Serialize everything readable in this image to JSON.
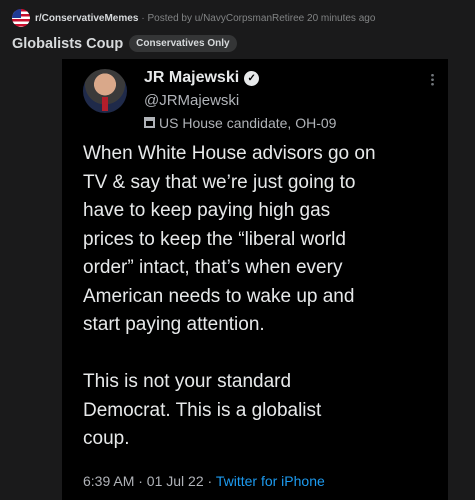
{
  "post": {
    "subreddit": "r/ConservativeMemes",
    "byline": "· Posted by u/NavyCorpsmanRetiree 20 minutes ago",
    "title": "Globalists Coup",
    "flair": "Conservatives Only"
  },
  "tweet": {
    "author_name": "JR Majewski",
    "verified_mark": "✓",
    "handle": "@JRMajewski",
    "label": "US House candidate, OH-09",
    "text": "When White House advisors go on\nTV & say that we’re just going to\nhave to keep paying high gas\nprices to keep the “liberal world\norder” intact, that’s when every\nAmerican needs to wake up and\nstart paying attention.\n\nThis is not your standard\nDemocrat. This is a globalist\ncoup.",
    "timestamp": "6:39 AM · 01 Jul 22 · ",
    "source": "Twitter for iPhone"
  },
  "colors": {
    "page_bg": "#1a1a1b",
    "tweet_bg": "#000000",
    "link_blue": "#1d9bf0"
  },
  "icons": [
    "us-flag-icon",
    "verified-icon",
    "building-icon",
    "more-icon"
  ]
}
